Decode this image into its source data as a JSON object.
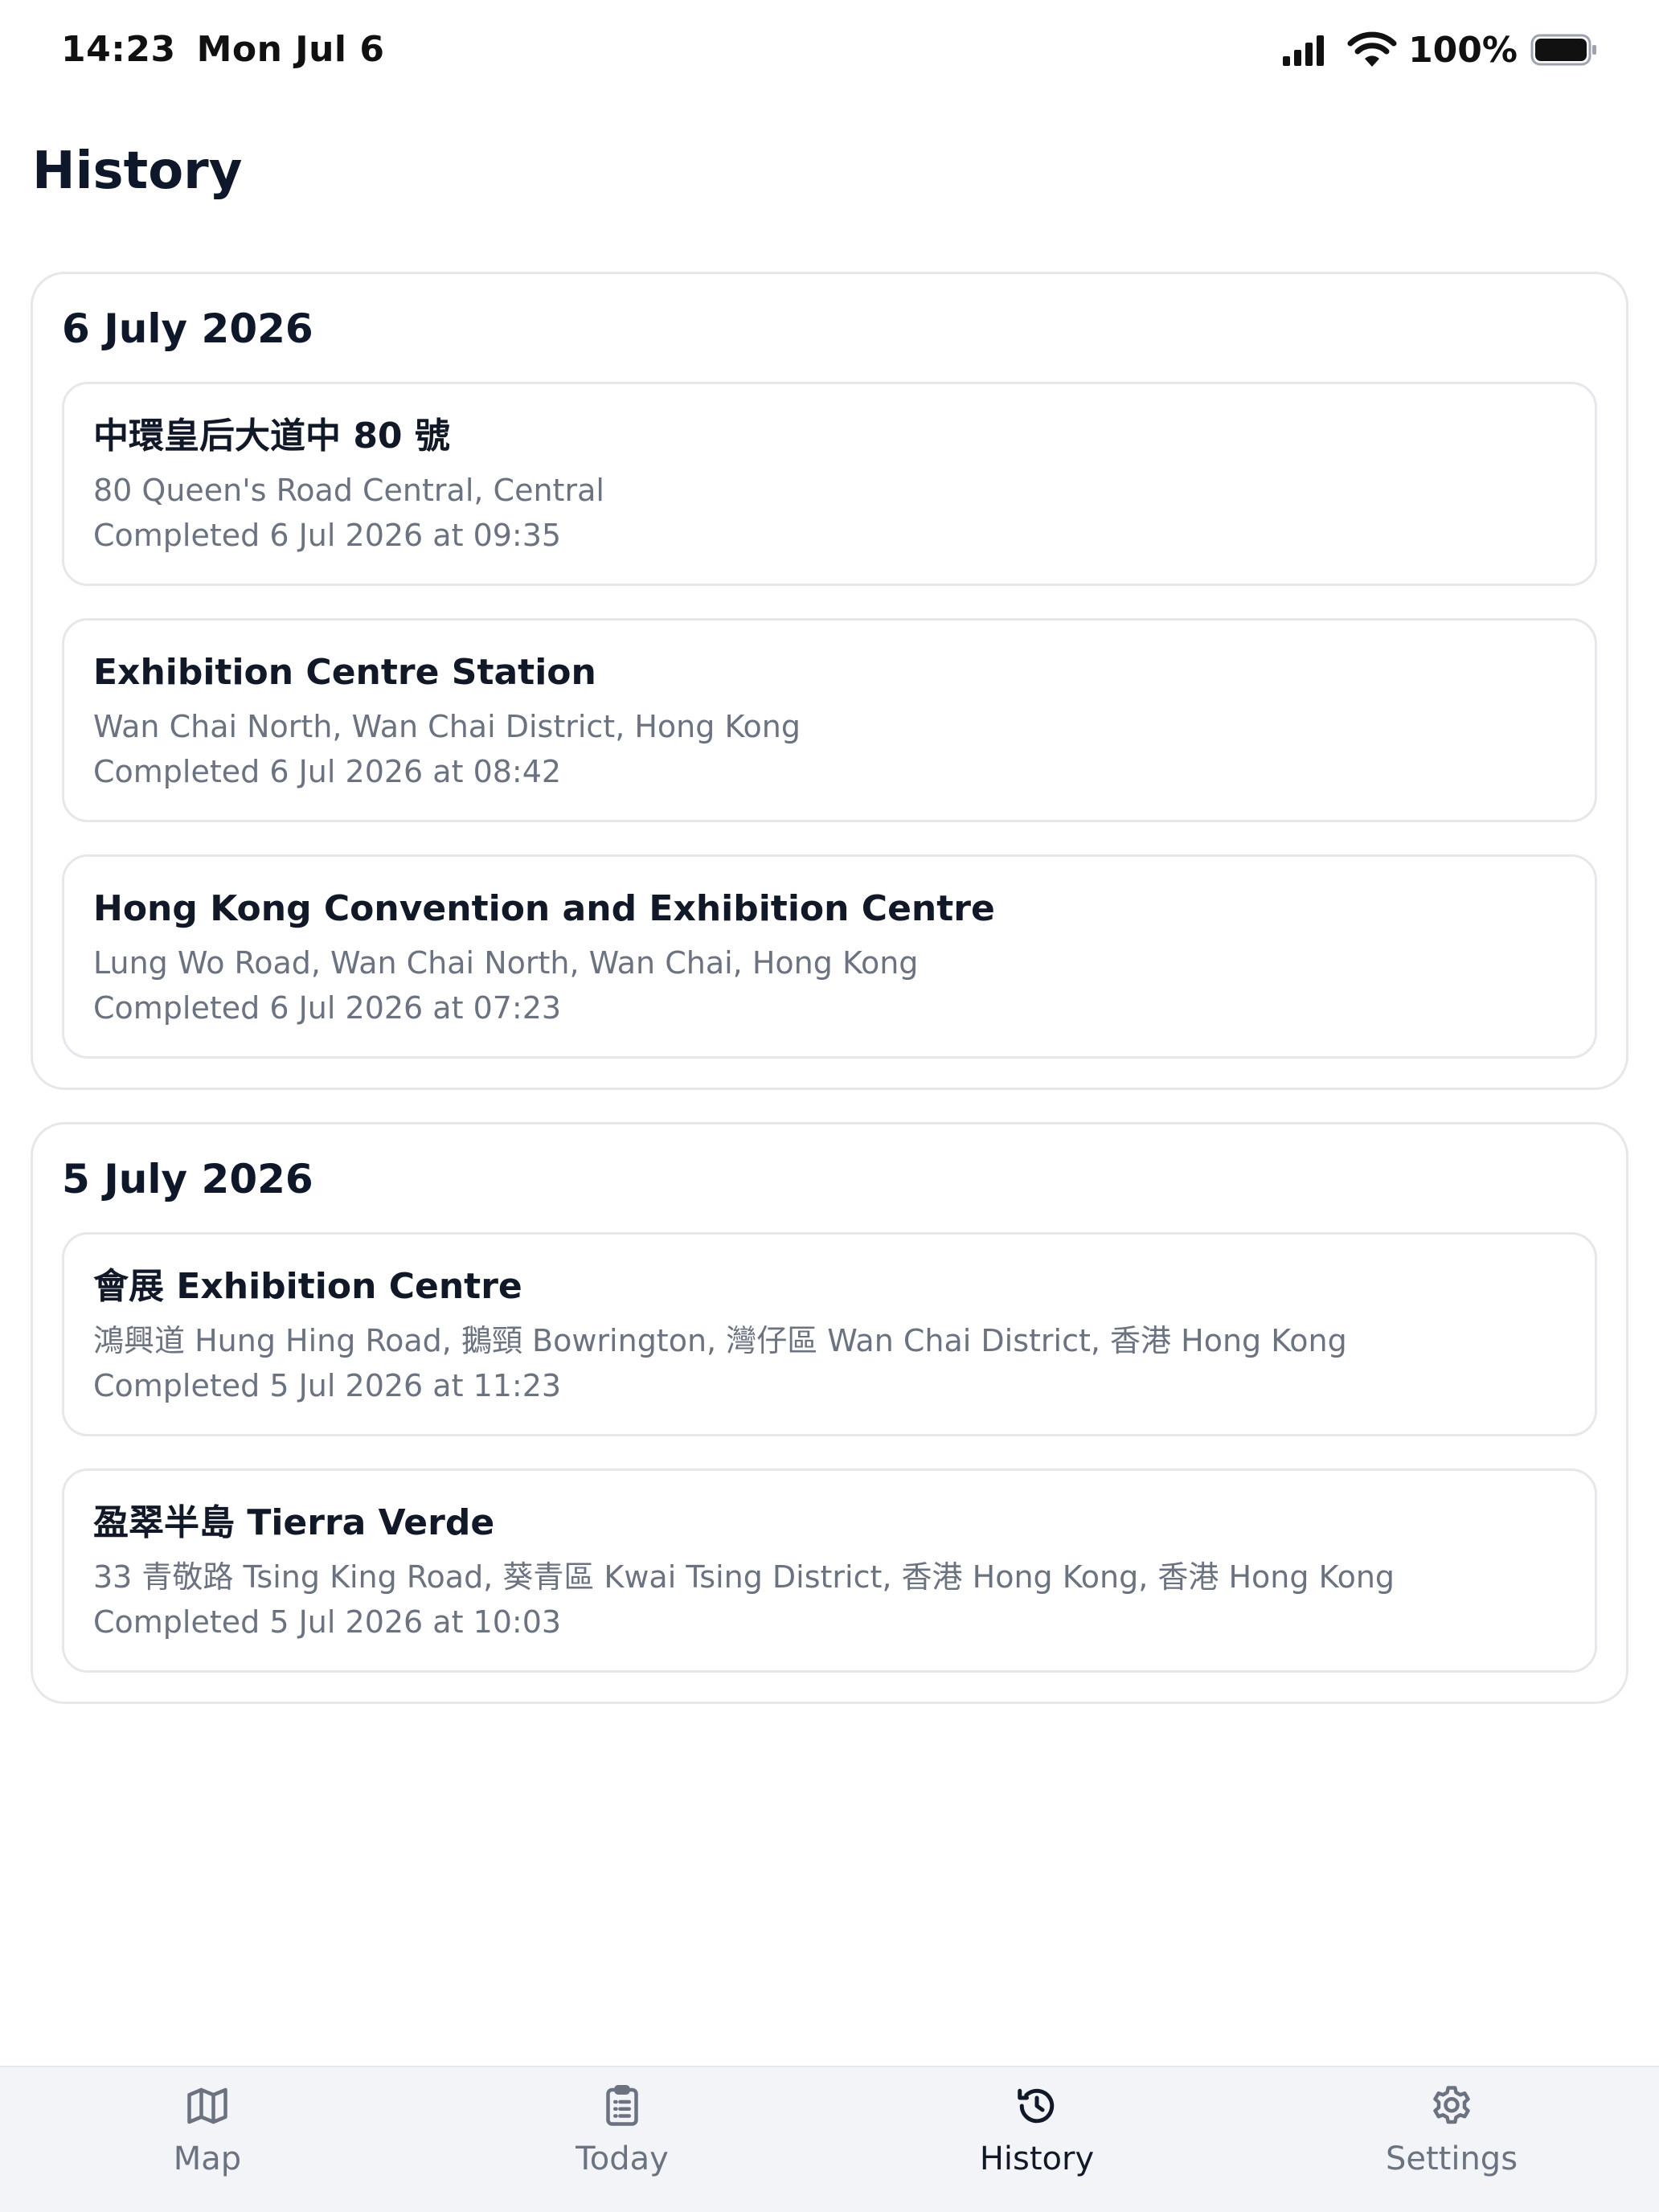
{
  "status_bar": {
    "time": "14:23",
    "date": "Mon Jul 6",
    "battery": "100%"
  },
  "page": {
    "title": "History"
  },
  "groups": [
    {
      "date": "6 July 2026",
      "items": [
        {
          "title": "中環皇后大道中 80 號",
          "address": "80 Queen's Road Central, Central",
          "completed": "Completed 6 Jul 2026 at 09:35"
        },
        {
          "title": "Exhibition Centre Station",
          "address": "Wan Chai North, Wan Chai District, Hong Kong",
          "completed": "Completed 6 Jul 2026 at 08:42"
        },
        {
          "title": "Hong Kong Convention and Exhibition Centre",
          "address": "Lung Wo Road, Wan Chai North, Wan Chai, Hong Kong",
          "completed": "Completed 6 Jul 2026 at 07:23"
        }
      ]
    },
    {
      "date": "5 July 2026",
      "items": [
        {
          "title": "會展 Exhibition Centre",
          "address": "鴻興道 Hung Hing Road, 鵝頸 Bowrington, 灣仔區 Wan Chai District, 香港 Hong Kong",
          "completed": "Completed 5 Jul 2026 at 11:23"
        },
        {
          "title": "盈翠半島 Tierra Verde",
          "address": "33 青敬路 Tsing King Road, 葵青區 Kwai Tsing District, 香港 Hong Kong, 香港 Hong Kong",
          "completed": "Completed 5 Jul 2026 at 10:03"
        }
      ]
    }
  ],
  "tabs": [
    {
      "label": "Map",
      "icon": "map-icon",
      "active": false
    },
    {
      "label": "Today",
      "icon": "clipboard-icon",
      "active": false
    },
    {
      "label": "History",
      "icon": "history-icon",
      "active": true
    },
    {
      "label": "Settings",
      "icon": "gear-icon",
      "active": false
    }
  ],
  "colors": {
    "active_tab": "#111827",
    "inactive_tab": "#6b7280",
    "tab_bar_bg": "#f3f4f7",
    "card_border": "#e5e7eb"
  }
}
